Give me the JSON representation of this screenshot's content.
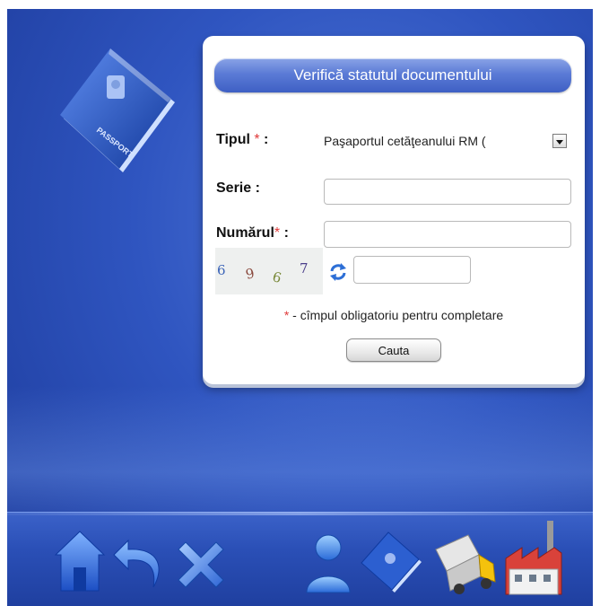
{
  "panel": {
    "title": "Verifică statutul documentului"
  },
  "form": {
    "type_label": "Tipul",
    "type_required_mark": "*",
    "type_colon": " :",
    "type_value": "Paşaportul cetăţeanului RM (",
    "serie_label": "Serie :",
    "serie_value": "",
    "number_label": "Numărul",
    "number_required_mark": "*",
    "number_colon": " :",
    "number_value": "",
    "captcha_digits": [
      "6",
      "9",
      "6",
      "7"
    ],
    "captcha_value": "",
    "note_mark": "*",
    "note_text": " - cîmpul obligatoriu pentru completare",
    "submit_label": "Cauta"
  },
  "decoration": {
    "passport_text": "PASSPORT"
  },
  "nav": {
    "icons": [
      "home-icon",
      "back-icon",
      "close-icon",
      "user-icon",
      "passport-icon",
      "truck-icon",
      "factory-icon"
    ]
  },
  "colors": {
    "background_blue": "#2f55c0",
    "title_bar": "#5b7bd6",
    "required_red": "#e03a3a"
  }
}
